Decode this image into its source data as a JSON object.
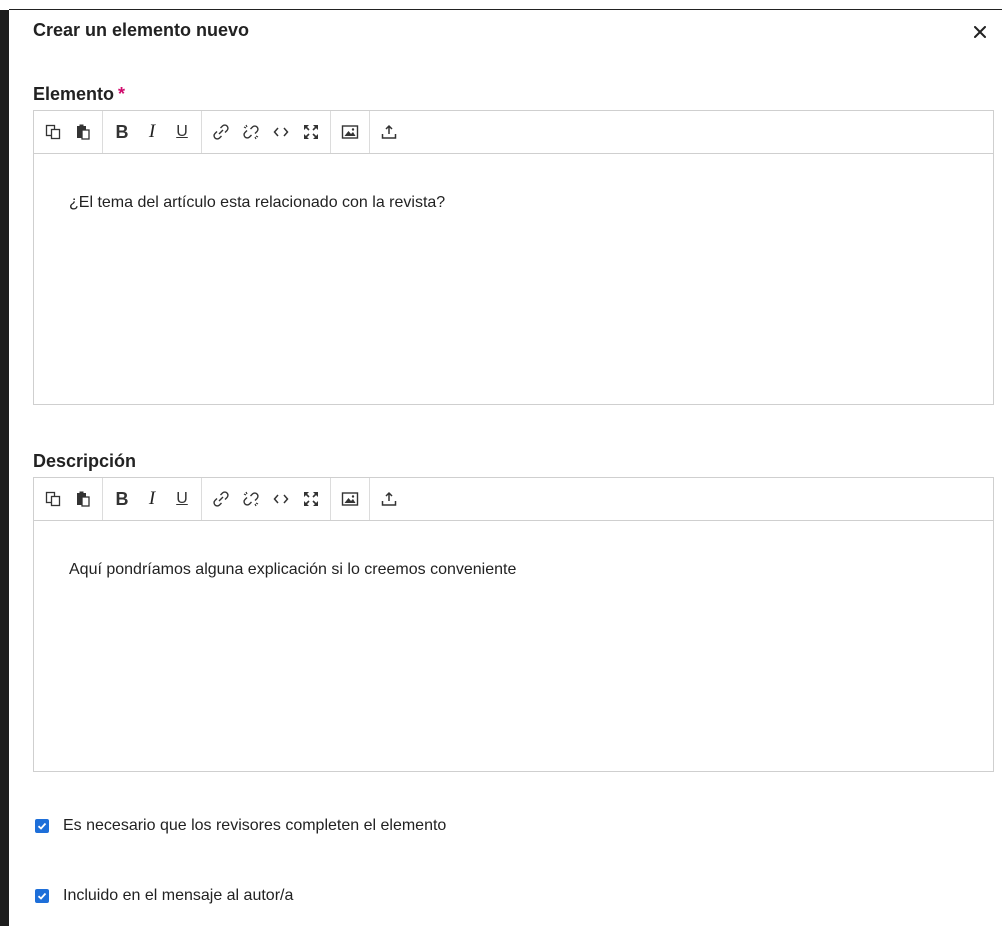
{
  "dialog": {
    "title": "Crear un elemento nuevo",
    "close_label": "×"
  },
  "fields": {
    "item": {
      "label": "Elemento",
      "required_mark": "*",
      "value": "¿El tema del artículo esta relacionado con la revista?"
    },
    "description": {
      "label": "Descripción",
      "value": "Aquí pondríamos alguna explicación si lo creemos conveniente"
    }
  },
  "toolbar": {
    "bold": "B",
    "italic": "I",
    "underline": "U",
    "icons": [
      "copy-icon",
      "paste-icon",
      "bold-icon",
      "italic-icon",
      "underline-icon",
      "link-icon",
      "unlink-icon",
      "code-icon",
      "fullscreen-icon",
      "image-icon",
      "upload-icon"
    ]
  },
  "checkboxes": [
    {
      "label": "Es necesario que los revisores completen el elemento",
      "checked": true
    },
    {
      "label": "Incluido en el mensaje al autor/a",
      "checked": true
    }
  ],
  "colors": {
    "required": "#d00a6c",
    "checkbox": "#1e6fd9",
    "border": "#cfcfcf"
  }
}
